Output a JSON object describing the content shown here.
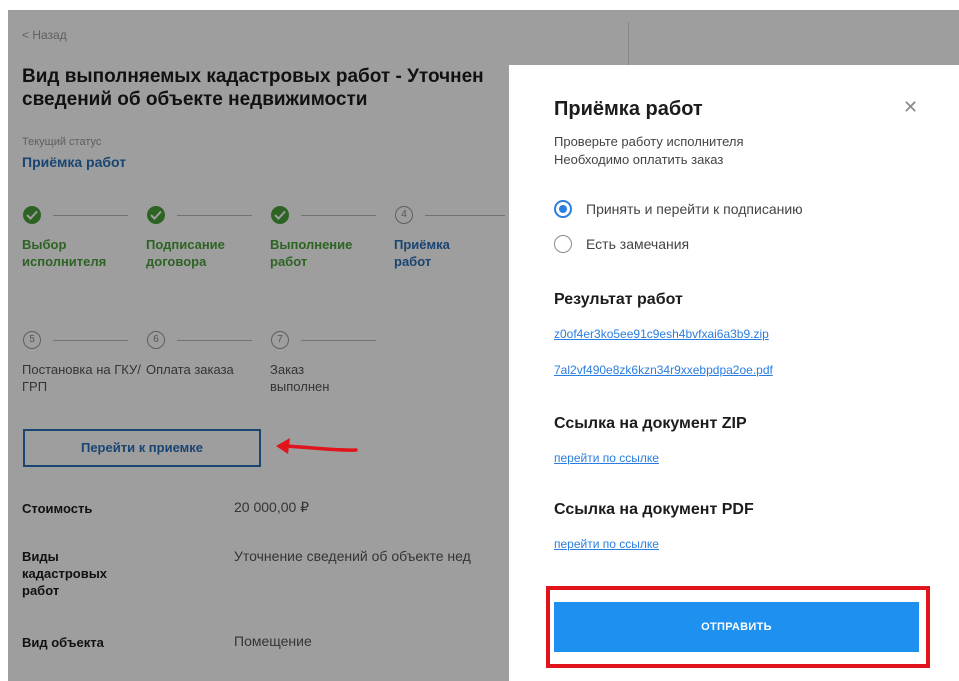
{
  "background": {
    "back_label": "< Назад",
    "title_line1": "Вид выполняемых кадастровых работ - Уточнен",
    "title_line2": "сведений об объекте недвижимости",
    "status_label": "Текущий статус",
    "status_value": "Приёмка работ",
    "steps": [
      {
        "label": "Выбор исполнителя",
        "state": "done",
        "number": ""
      },
      {
        "label": "Подписание договора",
        "state": "done",
        "number": ""
      },
      {
        "label": "Выполнение работ",
        "state": "done",
        "number": ""
      },
      {
        "label": "Приёмка работ",
        "state": "active",
        "number": "4"
      },
      {
        "label": "Постановка на ГКУ/ГРП",
        "state": "pending",
        "number": "5"
      },
      {
        "label": "Оплата заказа",
        "state": "pending",
        "number": "6"
      },
      {
        "label": "Заказ выполнен",
        "state": "pending",
        "number": "7"
      }
    ],
    "goto_button": "Перейти к приемке",
    "info": [
      {
        "label": "Стоимость",
        "value": "20 000,00 ₽"
      },
      {
        "label": "Виды кадастровых работ",
        "value": "Уточнение сведений об объекте нед"
      },
      {
        "label": "Вид объекта",
        "value": "Помещение"
      }
    ],
    "arrow_icon": "red-arrow-icon"
  },
  "modal": {
    "title": "Приёмка работ",
    "close_icon": "close-icon",
    "subtitle_line1": "Проверьте работу исполнителя",
    "subtitle_line2": "Необходимо оплатить заказ",
    "radio_options": [
      {
        "label": "Принять и перейти к подписанию",
        "checked": true
      },
      {
        "label": "Есть замечания",
        "checked": false
      }
    ],
    "results_heading": "Результат работ",
    "files": [
      "z0of4er3ko5ee91c9esh4bvfxai6a3b9.zip",
      "7al2vf490e8zk6kzn34r9xxebpdpa2oe.pdf"
    ],
    "zip_heading": "Ссылка на документ ZIP",
    "zip_link": "перейти по ссылке",
    "pdf_heading": "Ссылка на документ PDF",
    "pdf_link": "перейти по ссылке",
    "submit_label": "ОТПРАВИТЬ"
  },
  "colors": {
    "accent": "#2a7de1",
    "done_green": "#4aa23a",
    "highlight_red": "#e0141a",
    "submit_blue": "#1e90f0"
  }
}
